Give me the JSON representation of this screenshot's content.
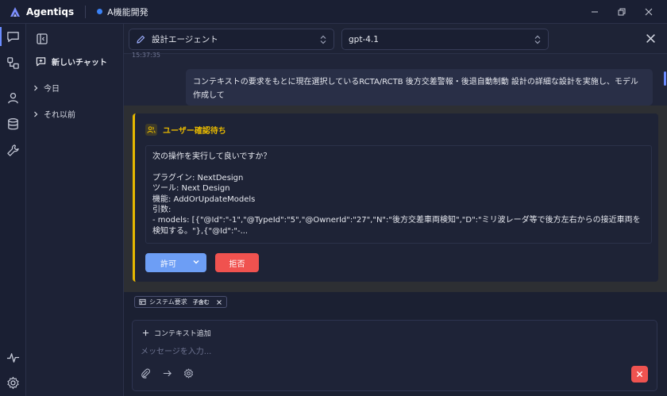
{
  "app": {
    "name": "Agentiqs",
    "project": "A機能開発"
  },
  "sidebar": {
    "new_chat": "新しいチャット",
    "groups": [
      {
        "label": "今日"
      },
      {
        "label": "それ以前"
      }
    ]
  },
  "topbar": {
    "agent": "設計エージェント",
    "model": "gpt-4.1"
  },
  "chat": {
    "timestamp": "15:37:35",
    "user_message": "コンテキストの要求をもとに現在選択しているRCTA/RCTB 後方交差警報・後退自動制動 設計の詳細な設計を実施し、モデル作成して"
  },
  "confirm": {
    "title": "ユーザー確認待ち",
    "body": "次の操作を実行して良いですか？\n\nプラグイン: NextDesign\nツール: Next Design\n機能: AddOrUpdateModels\n引数:\n- models: [{\"@Id\":\"-1\",\"@TypeId\":\"5\",\"@OwnerId\":\"27\",\"N\":\"後方交差車両検知\",\"D\":\"ミリ波レーダ等で後方左右からの接近車両を検知する。\"},{\"@Id\":\"-...",
    "allow": "許可",
    "reject": "拒否"
  },
  "composer": {
    "chip_label": "システム要求",
    "chip_sub": "子含む",
    "add_context": "コンテキスト追加",
    "placeholder": "メッセージを入力..."
  },
  "colors": {
    "accent": "#6d9ef5",
    "warning": "#e6b800",
    "danger": "#f0524f"
  }
}
